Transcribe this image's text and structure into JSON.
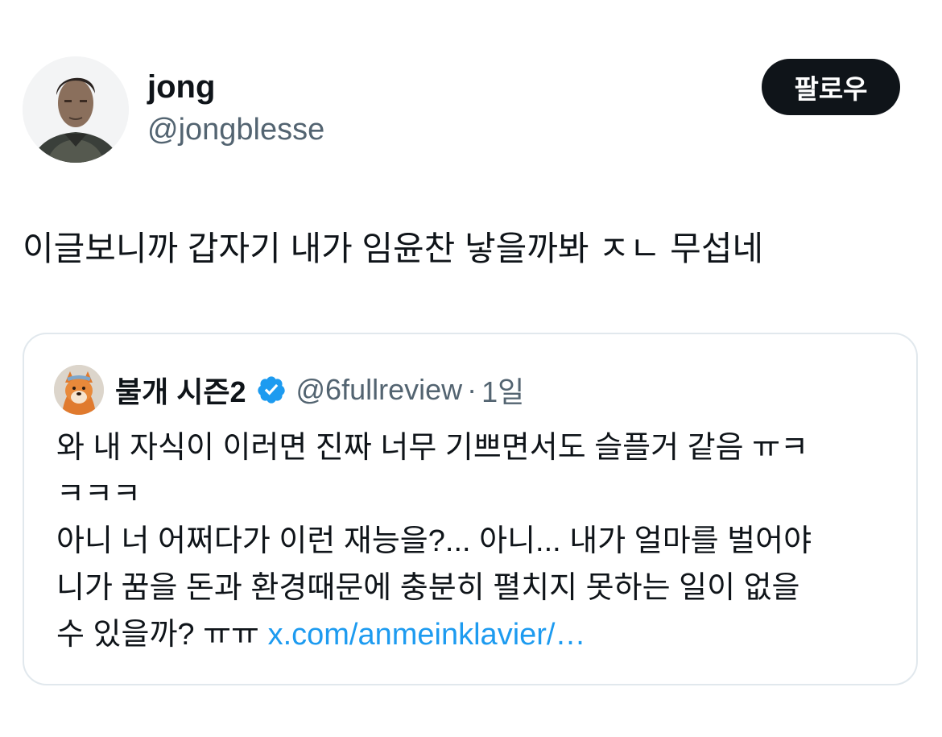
{
  "author": {
    "display_name": "jong",
    "handle": "@jongblesse",
    "avatar_icon": "profile-photo-man"
  },
  "follow_button": {
    "label": "팔로우"
  },
  "tweet": {
    "text": "이글보니까 갑자기 내가 임윤찬 낳을까봐 ㅈㄴ 무섭네"
  },
  "quoted_tweet": {
    "display_name": "불개 시즌2",
    "verified_icon": "verified-badge-icon",
    "handle": "@6fullreview",
    "separator": "·",
    "time": "1일",
    "lines": [
      "와 내 자식이 이러면 진짜 너무 기쁘면서도 슬플거 같음 ㅠㅋ",
      "ㅋㅋㅋ",
      "아니 너 어쩌다가 이런 재능을?... 아니... 내가 얼마를 벌어야",
      "니가 꿈을 돈과 환경때문에 충분히 펼치지 못하는 일이 없을"
    ],
    "last_line_text": "수 있을까? ㅠㅠ ",
    "link": "x.com/anmeinklavier/…",
    "avatar_icon": "shiba-dog-avatar"
  },
  "colors": {
    "text_primary": "#0f1419",
    "text_secondary": "#536471",
    "link": "#1d9bf0",
    "border": "#e1e8ed",
    "button_bg": "#0f1419"
  }
}
